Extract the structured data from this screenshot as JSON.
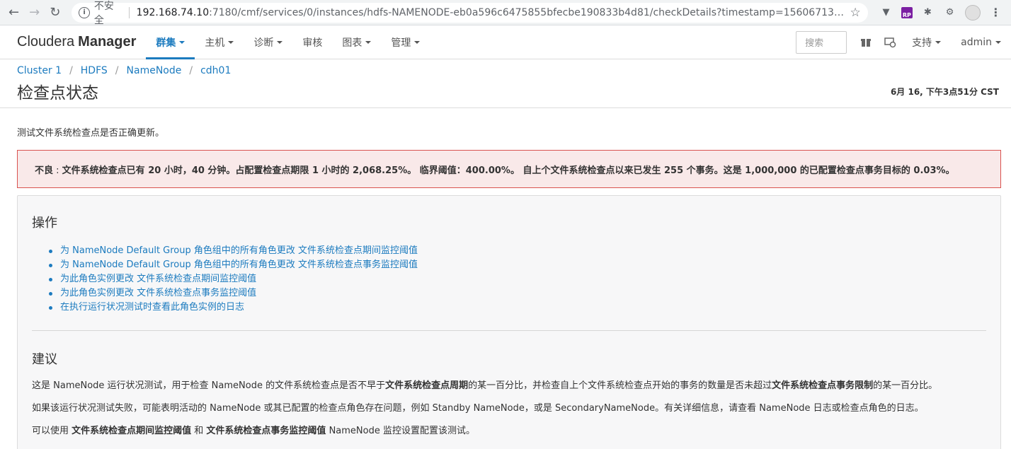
{
  "browser": {
    "insecure_label": "不安全",
    "url_host": "192.168.74.10",
    "url_path": ":7180/cmf/services/0/instances/hdfs-NAMENODE-eb0a596c6475855bfecbe190833b4d81/checkDetails?timestamp=156067136393..."
  },
  "app": {
    "brand_light": "Cloudera",
    "brand_bold": "Manager",
    "nav": [
      {
        "label": "群集",
        "dropdown": true,
        "active": true
      },
      {
        "label": "主机",
        "dropdown": true
      },
      {
        "label": "诊断",
        "dropdown": true
      },
      {
        "label": "审核",
        "dropdown": false
      },
      {
        "label": "图表",
        "dropdown": true
      },
      {
        "label": "管理",
        "dropdown": true
      }
    ],
    "search_placeholder": "搜索",
    "support_label": "支持",
    "user_label": "admin"
  },
  "breadcrumb": [
    "Cluster 1",
    "HDFS",
    "NameNode",
    "cdh01"
  ],
  "page": {
    "title": "检查点状态",
    "timestamp": "6月 16, 下午3点51分 CST",
    "description": "测试文件系统检查点是否正确更新。"
  },
  "alert": {
    "level": "不良",
    "separator": " : ",
    "message": "文件系统检查点已有 20 小时，40 分钟。占配置检查点期限 1 小时的 2,068.25%。 临界阈值：400.00%。 自上个文件系统检查点以来已发生 255 个事务。这是 1,000,000 的已配置检查点事务目标的 0.03%。",
    "color": "#d9534f"
  },
  "actions": {
    "heading": "操作",
    "items": [
      "为 NameNode Default Group 角色组中的所有角色更改 文件系统检查点期间监控阈值",
      "为 NameNode Default Group 角色组中的所有角色更改 文件系统检查点事务监控阈值",
      "为此角色实例更改 文件系统检查点期间监控阈值",
      "为此角色实例更改 文件系统检查点事务监控阈值",
      "在执行运行状况测试时查看此角色实例的日志"
    ]
  },
  "advice": {
    "heading": "建议",
    "p1_a": "这是 NameNode 运行状况测试，用于检查 NameNode 的文件系统检查点是否不早于",
    "p1_b": "文件系统检查点周期",
    "p1_c": "的某一百分比，并检查自上个文件系统检查点开始的事务的数量是否未超过",
    "p1_d": "文件系统检查点事务限制",
    "p1_e": "的某一百分比。",
    "p2": "如果该运行状况测试失败，可能表明活动的 NameNode 或其已配置的检查点角色存在问题，例如 Standby NameNode，或是 SecondaryNameNode。有关详细信息，请查看 NameNode 日志或检查点角色的日志。",
    "p3_a": "可以使用 ",
    "p3_b": "文件系统检查点期间监控阈值",
    "p3_c": " 和 ",
    "p3_d": "文件系统检查点事务监控阈值",
    "p3_e": " NameNode 监控设置配置该测试。"
  },
  "colors": {
    "link": "#1c7bbf",
    "alert_border": "#d9534f",
    "alert_bg": "#f9e9e9"
  }
}
